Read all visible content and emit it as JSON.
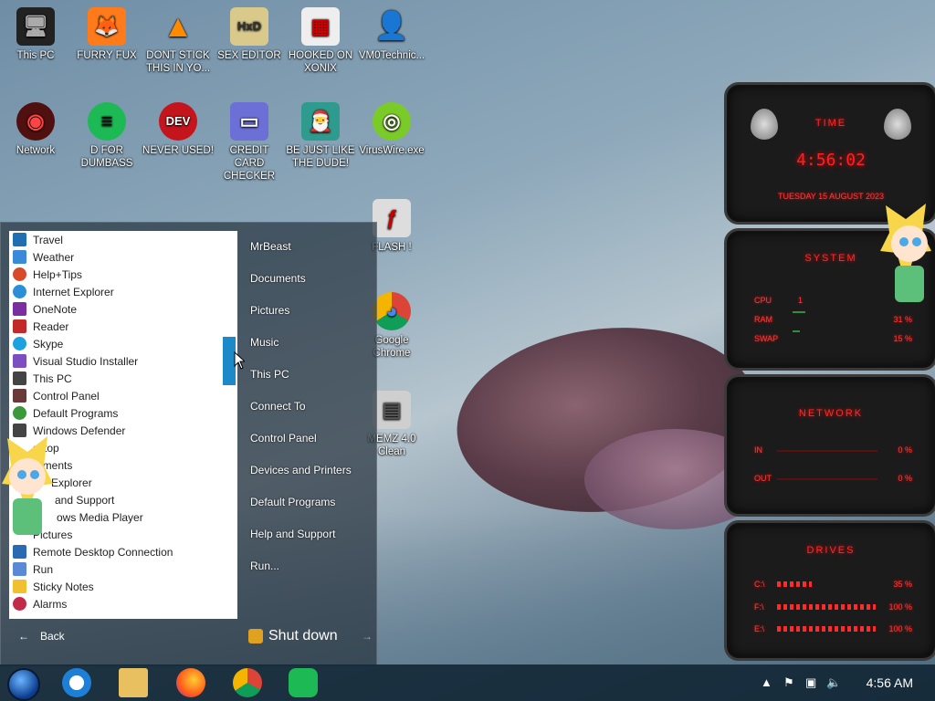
{
  "desktop_icons": [
    {
      "label": "This PC",
      "color": "#333",
      "glyph": "🖥"
    },
    {
      "label": "FURRY FUX",
      "color": "#ff7a1a",
      "glyph": "🦊"
    },
    {
      "label": "DONT STICK THIS IN YO...",
      "color": "#ff8a00",
      "glyph": "▲"
    },
    {
      "label": "SEX EDITOR",
      "color": "#d9c98a",
      "glyph": "HxD"
    },
    {
      "label": "HOOKED ON XONIX",
      "color": "#eee",
      "glyph": "▦"
    },
    {
      "label": "VM0Technic...",
      "color": "#e9c8a0",
      "glyph": "👤"
    },
    {
      "label": "Network",
      "color": "#a01818",
      "glyph": "◉"
    },
    {
      "label": "D FOR DUMBASS",
      "color": "#1db954",
      "glyph": "≡"
    },
    {
      "label": "NEVER USED!",
      "color": "#c4151c",
      "glyph": "DEV"
    },
    {
      "label": "CREDIT CARD CHECKER",
      "color": "#6b6fd6",
      "glyph": "▭"
    },
    {
      "label": "BE JUST LIKE THE DUDE!",
      "color": "#2f9a8e",
      "glyph": "🎅"
    },
    {
      "label": "VirusWire.exe",
      "color": "#7acb28",
      "glyph": "◎"
    },
    {
      "label": "FLASH !",
      "color": "#ddd",
      "glyph": "ƒ"
    },
    {
      "label": "Google Chrome",
      "color": "#e6e6e6",
      "glyph": "◕"
    },
    {
      "label": "MEMZ 4.0 Clean",
      "color": "#cfcfcf",
      "glyph": "▤"
    }
  ],
  "start_menu": {
    "apps": [
      {
        "label": "Travel",
        "color": "#1f6fb2"
      },
      {
        "label": "Weather",
        "color": "#3b8ad9"
      },
      {
        "label": "Help+Tips",
        "color": "#d84a2a"
      },
      {
        "label": "Internet Explorer",
        "color": "#2a8fd6"
      },
      {
        "label": "OneNote",
        "color": "#7a2ea0"
      },
      {
        "label": "Reader",
        "color": "#c22a2a"
      },
      {
        "label": "Skype",
        "color": "#1ea1e0"
      },
      {
        "label": "Visual Studio Installer",
        "color": "#7d4ec2"
      },
      {
        "label": "This PC",
        "color": "#444"
      },
      {
        "label": "Control Panel",
        "color": "#6a3a3a"
      },
      {
        "label": "Default Programs",
        "color": "#3a9a3a"
      },
      {
        "label": "Windows Defender",
        "color": "#444"
      },
      {
        "label": "sktop",
        "color": "#333"
      },
      {
        "label": "uments",
        "color": "#777"
      },
      {
        "label": "Explorer",
        "color": "#e0b040"
      },
      {
        "label": "and Support",
        "color": "#2a6ad6"
      },
      {
        "label": "ows Media Player",
        "color": "#e07a1a"
      },
      {
        "label": "Pictures",
        "color": "#6a9ad6"
      },
      {
        "label": "Remote Desktop Connection",
        "color": "#2a6ab2"
      },
      {
        "label": "Run",
        "color": "#5a8ad6"
      },
      {
        "label": "Sticky Notes",
        "color": "#f0c030"
      },
      {
        "label": "Alarms",
        "color": "#c22a4a"
      }
    ],
    "back": "Back",
    "places": [
      "MrBeast",
      "Documents",
      "Pictures",
      "Music",
      "This PC",
      "Connect To",
      "Control Panel",
      "Devices and Printers",
      "Default Programs",
      "Help and Support",
      "Run..."
    ],
    "shutdown": "Shut down"
  },
  "gadget": {
    "time_title": "TIME",
    "time": "4:56:02",
    "date": "TUESDAY 15 AUGUST 2023",
    "system_title": "SYSTEM",
    "system_rows": [
      {
        "label": "CPU",
        "value": "1"
      },
      {
        "label": "RAM",
        "value": "31 %"
      },
      {
        "label": "SWAP",
        "value": "15 %"
      }
    ],
    "network_title": "NETWORK",
    "network_rows": [
      {
        "label": "IN",
        "value": "0 %"
      },
      {
        "label": "OUT",
        "value": "0 %"
      }
    ],
    "drives_title": "DRIVES",
    "drive_rows": [
      {
        "label": "C:\\",
        "value": "35 %"
      },
      {
        "label": "F:\\",
        "value": "100 %"
      },
      {
        "label": "E:\\",
        "value": "100 %"
      }
    ]
  },
  "taskbar": {
    "clock": "4:56 AM"
  }
}
